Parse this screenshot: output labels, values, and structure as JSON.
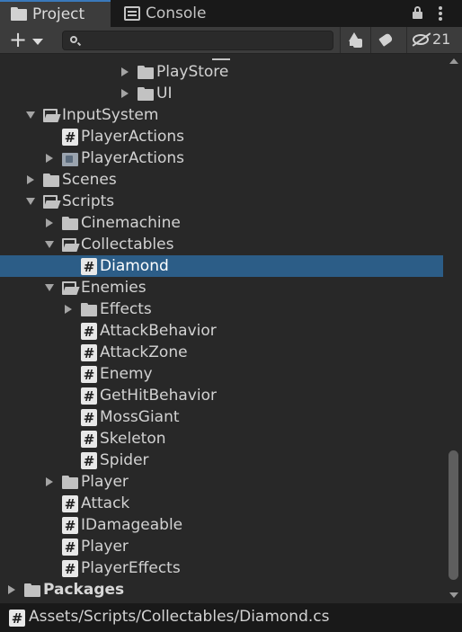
{
  "tabs": [
    {
      "label": "Project",
      "icon": "folder-icon",
      "active": true
    },
    {
      "label": "Console",
      "icon": "console-icon",
      "active": false
    }
  ],
  "toolbar": {
    "search_value": "",
    "hidden_count": "21"
  },
  "tree": {
    "rows": [
      {
        "label": "PlayStore",
        "icon": "folder",
        "arrow": "right",
        "level": 6
      },
      {
        "label": "UI",
        "icon": "folder",
        "arrow": "right",
        "level": 6
      },
      {
        "label": "InputSystem",
        "icon": "folder-open",
        "arrow": "down",
        "level": 1
      },
      {
        "label": "PlayerActions",
        "icon": "script",
        "arrow": "",
        "level": 2
      },
      {
        "label": "PlayerActions",
        "icon": "asset",
        "arrow": "right",
        "level": 2
      },
      {
        "label": "Scenes",
        "icon": "folder",
        "arrow": "right",
        "level": 1
      },
      {
        "label": "Scripts",
        "icon": "folder-open",
        "arrow": "down",
        "level": 1
      },
      {
        "label": "Cinemachine",
        "icon": "folder",
        "arrow": "right",
        "level": 2
      },
      {
        "label": "Collectables",
        "icon": "folder-open",
        "arrow": "down",
        "level": 2
      },
      {
        "label": "Diamond",
        "icon": "script",
        "arrow": "",
        "level": 3,
        "selected": true
      },
      {
        "label": "Enemies",
        "icon": "folder-open",
        "arrow": "down",
        "level": 2
      },
      {
        "label": "Effects",
        "icon": "folder",
        "arrow": "right",
        "level": 3
      },
      {
        "label": "AttackBehavior",
        "icon": "script",
        "arrow": "",
        "level": 3
      },
      {
        "label": "AttackZone",
        "icon": "script",
        "arrow": "",
        "level": 3
      },
      {
        "label": "Enemy",
        "icon": "script",
        "arrow": "",
        "level": 3
      },
      {
        "label": "GetHitBehavior",
        "icon": "script",
        "arrow": "",
        "level": 3
      },
      {
        "label": "MossGiant",
        "icon": "script",
        "arrow": "",
        "level": 3
      },
      {
        "label": "Skeleton",
        "icon": "script",
        "arrow": "",
        "level": 3
      },
      {
        "label": "Spider",
        "icon": "script",
        "arrow": "",
        "level": 3
      },
      {
        "label": "Player",
        "icon": "folder",
        "arrow": "right",
        "level": 2
      },
      {
        "label": "Attack",
        "icon": "script",
        "arrow": "",
        "level": 2
      },
      {
        "label": "IDamageable",
        "icon": "script",
        "arrow": "",
        "level": 2
      },
      {
        "label": "Player",
        "icon": "script",
        "arrow": "",
        "level": 2
      },
      {
        "label": "PlayerEffects",
        "icon": "script",
        "arrow": "",
        "level": 2
      },
      {
        "label": "Packages",
        "icon": "folder",
        "arrow": "right",
        "level": 0,
        "bold": true
      }
    ]
  },
  "status": {
    "path": "Assets/Scripts/Collectables/Diamond.cs"
  },
  "colors": {
    "selection": "#2c5d87",
    "active_tab_accent": "#3a79bb",
    "background": "#282828"
  }
}
